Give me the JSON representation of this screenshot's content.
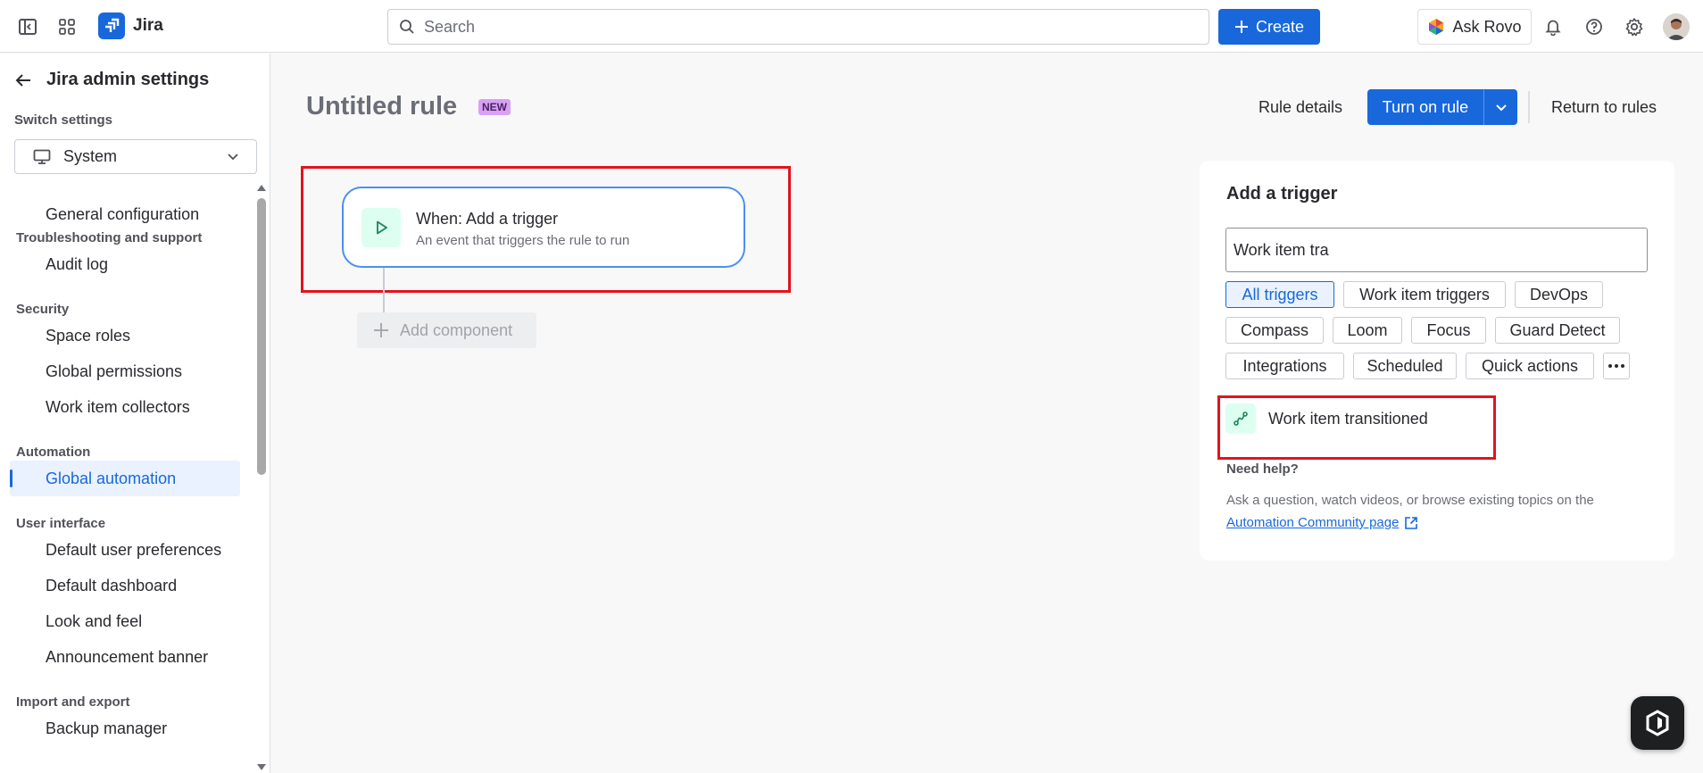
{
  "topbar": {
    "app_name": "Jira",
    "search_placeholder": "Search",
    "create_label": "Create",
    "rovo_label": "Ask Rovo"
  },
  "sidebar": {
    "title": "Jira admin settings",
    "switch_label": "Switch settings",
    "switch_value": "System",
    "items": [
      {
        "type": "item",
        "label": "General configuration"
      },
      {
        "type": "section",
        "label": "Troubleshooting and support"
      },
      {
        "type": "item",
        "label": "Audit log"
      },
      {
        "type": "section",
        "label": "Security"
      },
      {
        "type": "item",
        "label": "Space roles"
      },
      {
        "type": "item",
        "label": "Global permissions"
      },
      {
        "type": "item",
        "label": "Work item collectors"
      },
      {
        "type": "section",
        "label": "Automation"
      },
      {
        "type": "item",
        "label": "Global automation",
        "active": true
      },
      {
        "type": "section",
        "label": "User interface"
      },
      {
        "type": "item",
        "label": "Default user preferences"
      },
      {
        "type": "item",
        "label": "Default dashboard"
      },
      {
        "type": "item",
        "label": "Look and feel"
      },
      {
        "type": "item",
        "label": "Announcement banner"
      },
      {
        "type": "section",
        "label": "Import and export"
      },
      {
        "type": "item",
        "label": "Backup manager"
      }
    ]
  },
  "rule": {
    "title": "Untitled rule",
    "badge": "NEW",
    "details_label": "Rule details",
    "turn_on_label": "Turn on rule",
    "return_label": "Return to rules"
  },
  "trigger": {
    "title": "When: Add a trigger",
    "subtitle": "An event that triggers the rule to run",
    "add_component_label": "Add component"
  },
  "panel": {
    "title": "Add a trigger",
    "search_value": "Work item tra",
    "chips": [
      {
        "label": "All triggers",
        "selected": true
      },
      {
        "label": "Work item triggers"
      },
      {
        "label": "DevOps"
      },
      {
        "label": "Compass"
      },
      {
        "label": "Loom"
      },
      {
        "label": "Focus"
      },
      {
        "label": "Guard Detect"
      },
      {
        "label": "Integrations"
      },
      {
        "label": "Scheduled"
      },
      {
        "label": "Quick actions"
      }
    ],
    "result_label": "Work item transitioned",
    "help_title": "Need help?",
    "help_text": "Ask a question, watch videos, or browse existing topics on the",
    "help_link": "Automation Community page"
  },
  "colors": {
    "brand": "#1868db",
    "highlight": "#e0141e",
    "badge": "#d8a0f7",
    "trigger_bg": "#dcfff1"
  }
}
